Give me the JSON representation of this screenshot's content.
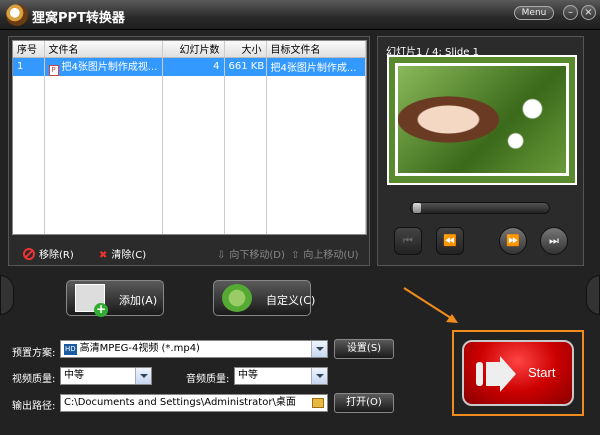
{
  "app": {
    "title": "狸窝PPT转换器",
    "menu_label": "Menu",
    "minimize": "–",
    "close": "×"
  },
  "file_table": {
    "headers": [
      "序号",
      "文件名",
      "幻灯片数",
      "大小",
      "目标文件名"
    ],
    "rows": [
      {
        "index": "1",
        "file_name": "把4张图片制作成视...",
        "slides": "4",
        "size": "661 KB",
        "target": "把4张图片制作成..."
      }
    ]
  },
  "file_actions": {
    "remove": "移除(R)",
    "clear": "清除(C)",
    "move_down": "向下移动(D)",
    "move_up": "向上移动(U)"
  },
  "preview": {
    "slide_label": "幻灯片1 / 4: Slide 1",
    "progress": 0.0
  },
  "buttons": {
    "add": "添加(A)",
    "custom": "自定义(C)",
    "start": "Start"
  },
  "settings": {
    "preset_label": "预置方案:",
    "preset_badge": "HD",
    "preset_value": "高清MPEG-4视频 (*.mp4)",
    "setup_button": "设置(S)",
    "video_quality_label": "视频质量:",
    "video_quality_value": "中等",
    "audio_quality_label": "音频质量:",
    "audio_quality_value": "中等",
    "output_label": "输出路径:",
    "output_path": "C:\\Documents and Settings\\Administrator\\桌面",
    "open_button": "打开(O)"
  },
  "colors": {
    "accent_orange": "#f08c1e",
    "selection_blue": "#3399ff",
    "start_red": "#cc0000"
  }
}
